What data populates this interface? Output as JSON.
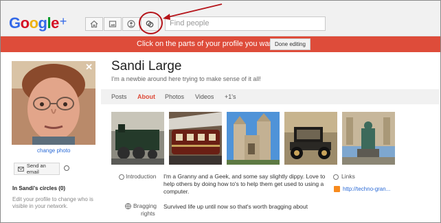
{
  "header": {
    "logo_text": "Google",
    "logo_plus": "+",
    "nav_icons": [
      "home-icon",
      "photos-icon",
      "profile-icon",
      "circles-icon"
    ],
    "search_placeholder": "Find people"
  },
  "banner": {
    "message": "Click on the parts of your profile you want to edit.",
    "done_label": "Done editing",
    "color": "#de4c3a"
  },
  "sidebar": {
    "change_photo": "change photo",
    "send_email": "Send an email",
    "circles_title": "In Sandi's circles (0)",
    "circles_hint": "Edit your profile to change who is visible in your network."
  },
  "profile": {
    "name": "Sandi Large",
    "tagline": "I'm a newbie around here trying to make sense of it all!",
    "tabs": [
      {
        "label": "Posts",
        "active": false
      },
      {
        "label": "About",
        "active": true
      },
      {
        "label": "Photos",
        "active": false
      },
      {
        "label": "Videos",
        "active": false
      },
      {
        "label": "+1's",
        "active": false
      }
    ]
  },
  "about": {
    "introduction_label": "Introduction",
    "introduction_text": "I'm a Granny and a Geek, and some say slightly dippy. Love to help others by doing how to's to help them get used to using a computer.",
    "bragging_label_1": "Bragging",
    "bragging_label_2": "rights",
    "bragging_text": "Survived life up until now so that's worth bragging about",
    "links_label": "Links",
    "link_url": "http://techno-gran..."
  },
  "colors": {
    "accent_red": "#dd4b39",
    "link_blue": "#2a6ad6",
    "annotation_red": "#b5141a"
  }
}
